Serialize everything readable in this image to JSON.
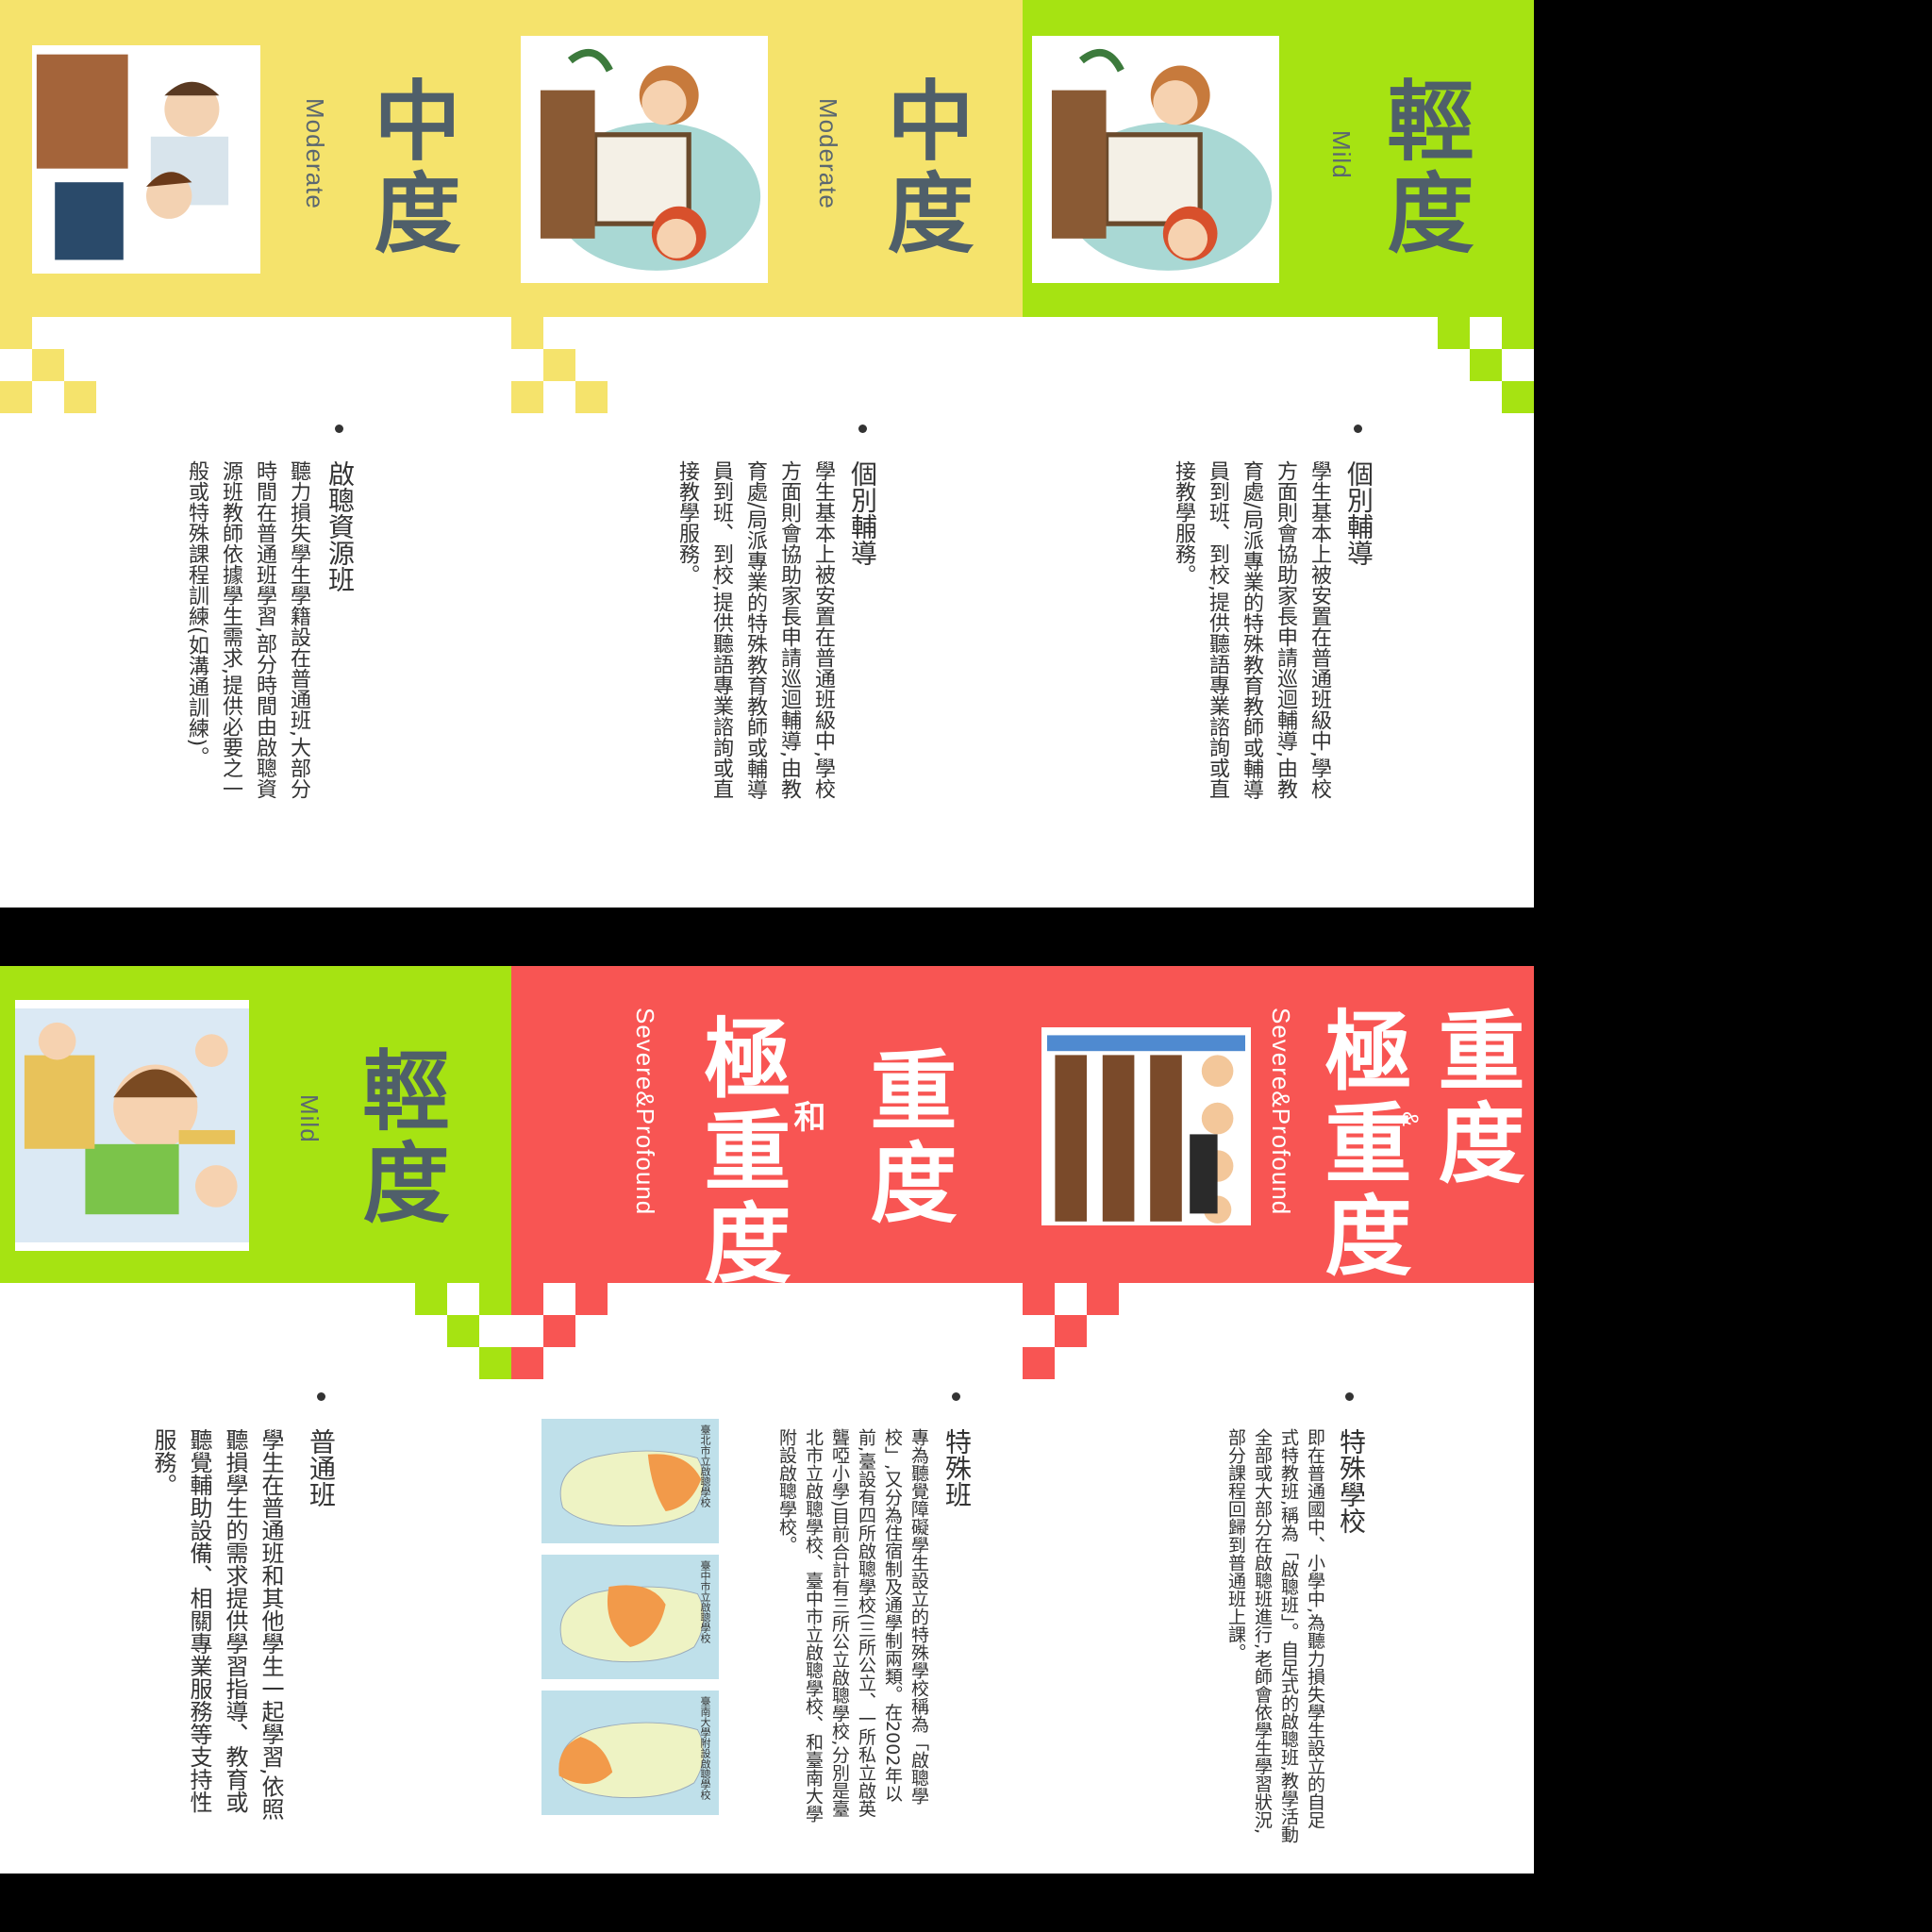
{
  "colors": {
    "green": "#a6e312",
    "yellow": "#f5e36c",
    "red": "#f85553",
    "text": "#4f5f6a"
  },
  "top": {
    "mild_panel": {
      "title": "輕度",
      "subtitle": "Mild",
      "heading": "個別輔導",
      "body": "學生基本上被安置在普通班級中,學校方面則會協助家長申請巡迴輔導,由教育處/局派專業的特殊教育教師或輔導員到班、到校,提供聽語專業諮詢或直接教學服務。"
    },
    "moderate_panel_1": {
      "title": "中度",
      "subtitle": "Moderate",
      "heading": "個別輔導",
      "body": "學生基本上被安置在普通班級中,學校方面則會協助家長申請巡迴輔導,由教育處/局派專業的特殊教育教師或輔導員到班、到校,提供聽語專業諮詢或直接教學服務。"
    },
    "moderate_panel_2": {
      "title": "中度",
      "subtitle": "Moderate",
      "heading": "啟聰資源班",
      "body": "聽力損失學生學籍設在普通班,大部分時間在普通班學習,部分時間由啟聰資源班教師依據學生需求,提供必要之一般或特殊課程訓練(如溝通訓練)。"
    }
  },
  "bottom": {
    "severe_panel_1": {
      "title_line1": "重度",
      "amp": "&",
      "title_line2": "極重度",
      "subtitle": "Severe&Profound",
      "heading": "特殊學校",
      "body": "即在普通國中、小學中,為聽力損失學生設立的自足式特教班,稱為「啟聰班」。自足式的啟聰班,教學活動全部或大部分在啟聰班進行,老師會依學生學習狀況,部分課程回歸到普通班上課。"
    },
    "severe_panel_2": {
      "title_line1": "重度",
      "amp": "和",
      "title_line2": "極重度",
      "subtitle": "Severe&Profound",
      "heading": "特殊班",
      "body": "專為聽覺障礙學生設立的特殊學校稱為「啟聰學校」,又分為住宿制及通學制兩類。在2002年以前,臺設有四所啟聰學校(三所公立、一所私立啟英聾啞小學)目前合計有三所公立啟聰學校,分別是臺北市立啟聰學校、臺中市立啟聰學校、和臺南大學附設啟聰學校。",
      "maps": [
        {
          "label": "臺北市立啟聰學校"
        },
        {
          "label": "臺中市立啟聰學校"
        },
        {
          "label": "臺南大學附設啟聰學校"
        }
      ]
    },
    "mild_panel": {
      "title": "輕度",
      "subtitle": "Mild",
      "heading": "普通班",
      "body": "學生在普通班和其他學生一起學習,依照聽損學生的需求提供學習指導、教育或聽覺輔助設備、相關專業服務等支持性服務。"
    }
  }
}
